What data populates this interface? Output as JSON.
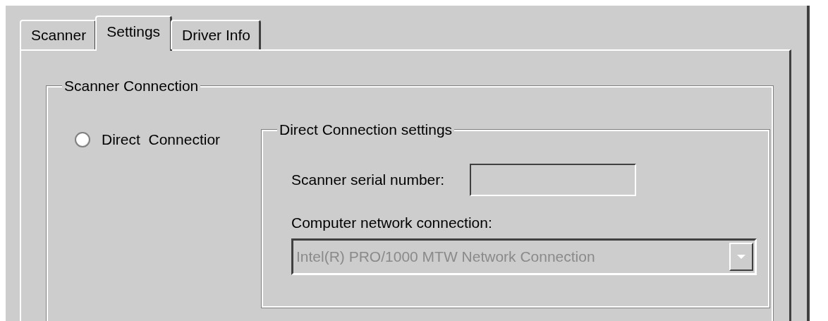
{
  "tabs": [
    {
      "label": "Scanner",
      "selected": false
    },
    {
      "label": "Settings",
      "selected": true
    },
    {
      "label": "Driver Info",
      "selected": false
    }
  ],
  "scanner_connection": {
    "title": "Scanner Connection",
    "radio": {
      "label": "Direct  Connectior",
      "selected": false
    },
    "direct_settings": {
      "title": "Direct Connection settings",
      "serial_label": "Scanner serial number:",
      "serial_field": {
        "disabled": true
      },
      "network_label": "Computer network connection:",
      "network_select": {
        "value": "Intel(R) PRO/1000 MTW Network Connection",
        "disabled": true
      }
    }
  }
}
